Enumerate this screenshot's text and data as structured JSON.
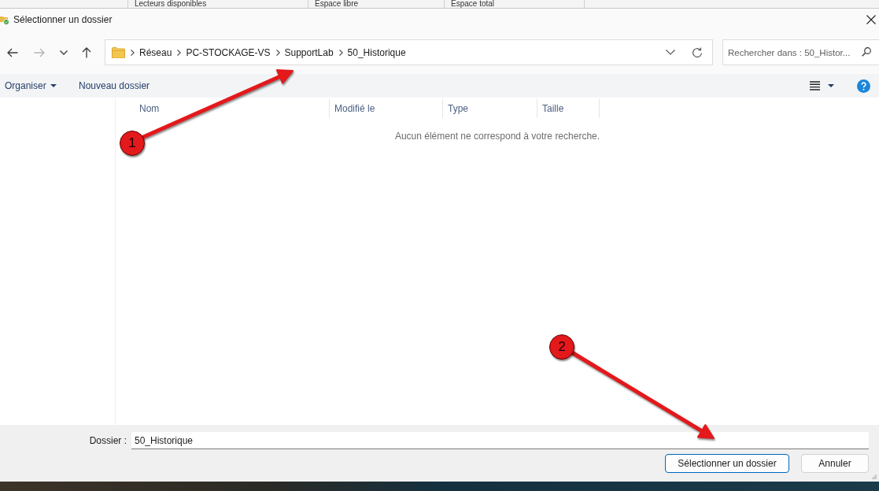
{
  "background_window": {
    "columns": [
      "Lecteurs disponibles",
      "Espace libre",
      "Espace total"
    ]
  },
  "window": {
    "title": "Sélectionner un dossier"
  },
  "navigation": {
    "buttons": [
      {
        "kind": "back",
        "disabled": false
      },
      {
        "kind": "forward",
        "disabled": true
      },
      {
        "kind": "recent",
        "disabled": false
      },
      {
        "kind": "up",
        "disabled": false
      }
    ]
  },
  "address_bar": {
    "path": [
      "Réseau",
      "PC-STOCKAGE-VS",
      "SupportLab",
      "50_Historique"
    ]
  },
  "search": {
    "placeholder": "Rechercher dans : 50_Histor..."
  },
  "toolbar": {
    "organize": "Organiser",
    "new_folder": "Nouveau dossier"
  },
  "file_list": {
    "columns": [
      "Nom",
      "Modifié le",
      "Type",
      "Taille"
    ],
    "empty_message": "Aucun élément ne correspond à votre recherche."
  },
  "folder_field": {
    "label": "Dossier :",
    "value": "50_Historique"
  },
  "buttons": [
    {
      "label": "Sélectionner un dossier",
      "default": true
    },
    {
      "label": "Annuler",
      "default": false
    }
  ],
  "annotations": [
    {
      "label": "1"
    },
    {
      "label": "2"
    }
  ]
}
